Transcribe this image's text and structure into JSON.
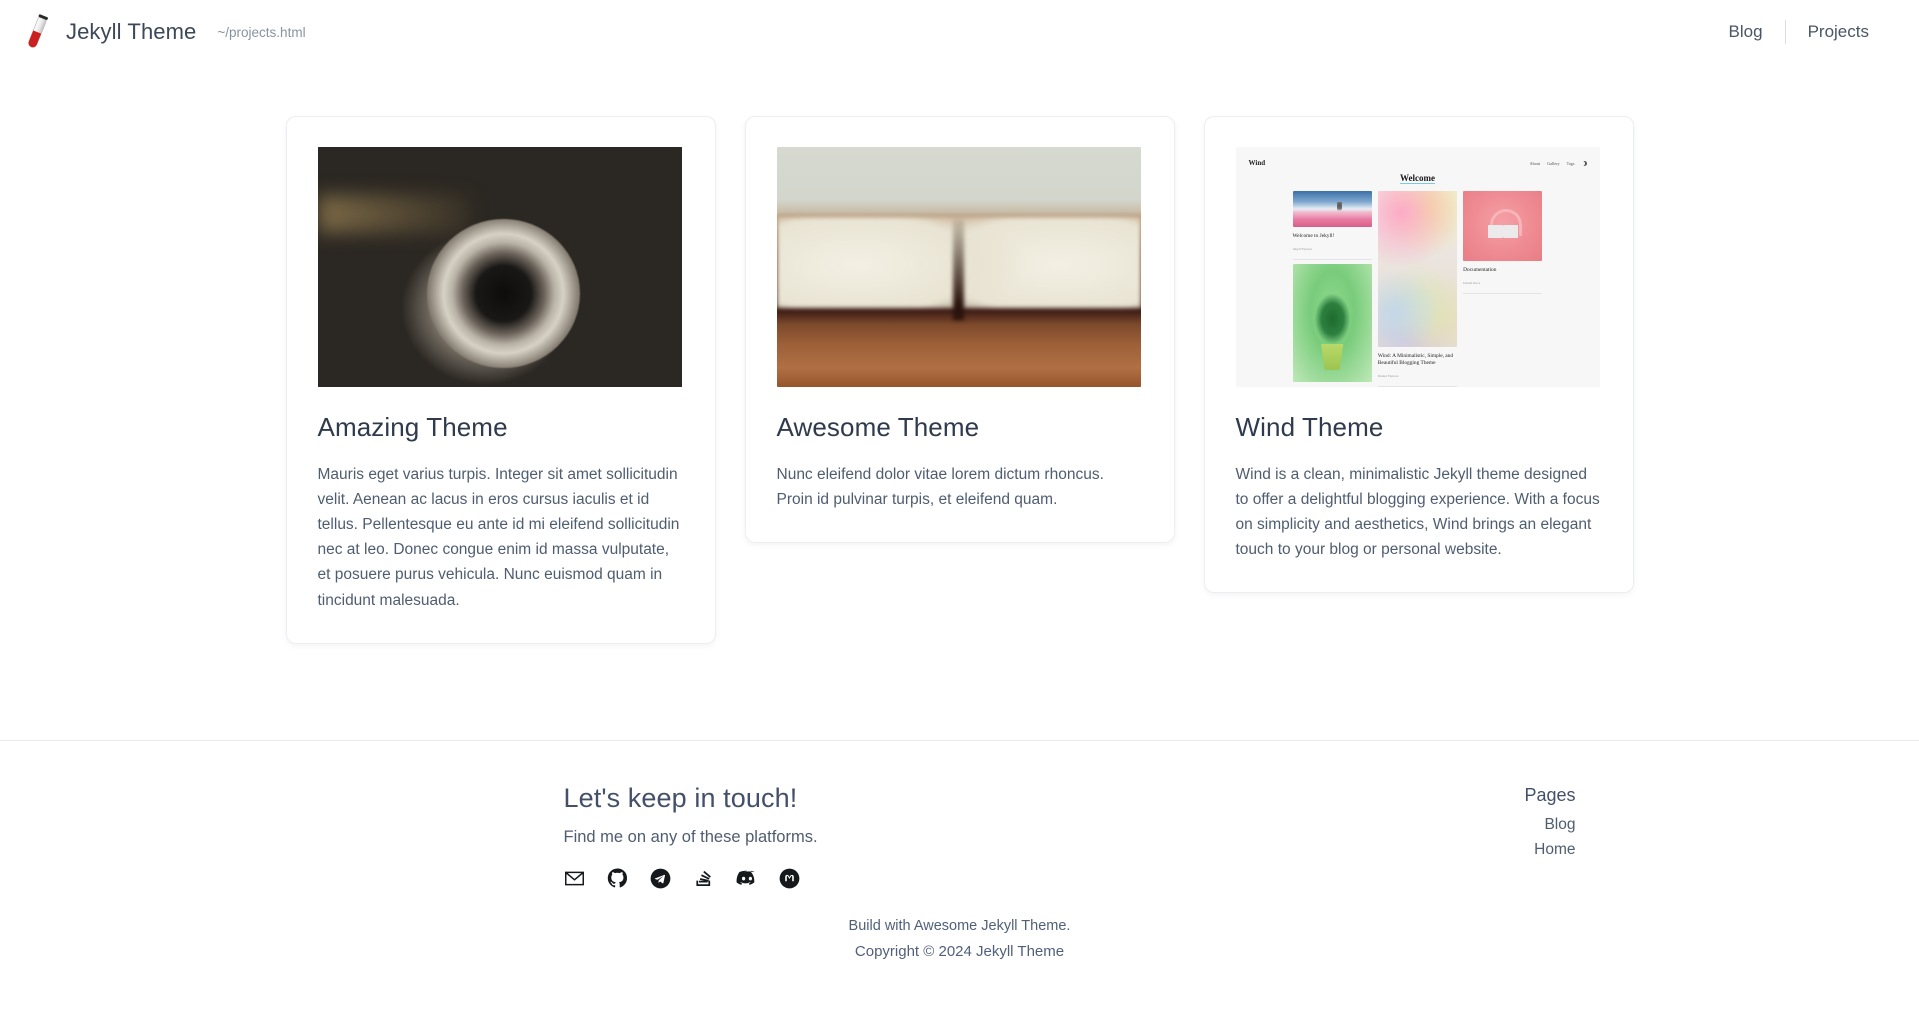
{
  "header": {
    "logo_icon": "test-tube-icon",
    "title": "Jekyll Theme",
    "path": "~/projects.html",
    "nav": [
      {
        "label": "Blog"
      },
      {
        "label": "Projects"
      }
    ]
  },
  "main": {
    "cards": [
      {
        "image_alt": "vintage-film-camera-photo",
        "title": "Amazing Theme",
        "text": "Mauris eget varius turpis. Integer sit amet sollicitudin velit. Aenean ac lacus in eros cursus iaculis et id tellus. Pellentesque eu ante id mi eleifend sollicitudin nec at leo. Donec congue enim id massa vulputate, et posuere purus vehicula. Nunc euismod quam in tincidunt malesuada."
      },
      {
        "image_alt": "open-book-on-table-photo",
        "title": "Awesome Theme",
        "text": "Nunc eleifend dolor vitae lorem dictum rhoncus. Proin id pulvinar turpis, et eleifend quam."
      },
      {
        "image_alt": "wind-theme-site-screenshot",
        "title": "Wind Theme",
        "text": "Wind is a clean, minimalistic Jekyll theme designed to offer a delightful blogging experience. With a focus on simplicity and aesthetics, Wind brings an elegant touch to your blog or personal website."
      }
    ]
  },
  "wind_preview": {
    "brand": "Wind",
    "nav": [
      "About",
      "Gallery",
      "Tags"
    ],
    "theme_toggle_icon": "moon-icon",
    "heading": "Welcome",
    "posts": [
      {
        "title": "Welcome to Jekyll!",
        "meta": "Jekyll Explore"
      },
      {
        "title": "Wind: A Minimalistic, Simple, and Beautiful Blogging Theme",
        "meta": "Daniel Explore"
      },
      {
        "title": "Documentation",
        "meta": "Daniel Docs"
      }
    ]
  },
  "footer": {
    "heading": "Let's keep in touch!",
    "subtitle": "Find me on any of these platforms.",
    "social": [
      {
        "name": "email-icon",
        "label": "Email"
      },
      {
        "name": "github-icon",
        "label": "GitHub"
      },
      {
        "name": "telegram-icon",
        "label": "Telegram"
      },
      {
        "name": "stackoverflow-icon",
        "label": "Stack Overflow"
      },
      {
        "name": "discord-icon",
        "label": "Discord"
      },
      {
        "name": "mastodon-icon",
        "label": "Mastodon"
      }
    ],
    "pages_heading": "Pages",
    "pages": [
      {
        "label": "Blog"
      },
      {
        "label": "Home"
      }
    ],
    "build_line": "Build with Awesome Jekyll Theme.",
    "copyright": "Copyright © 2024 Jekyll Theme"
  }
}
